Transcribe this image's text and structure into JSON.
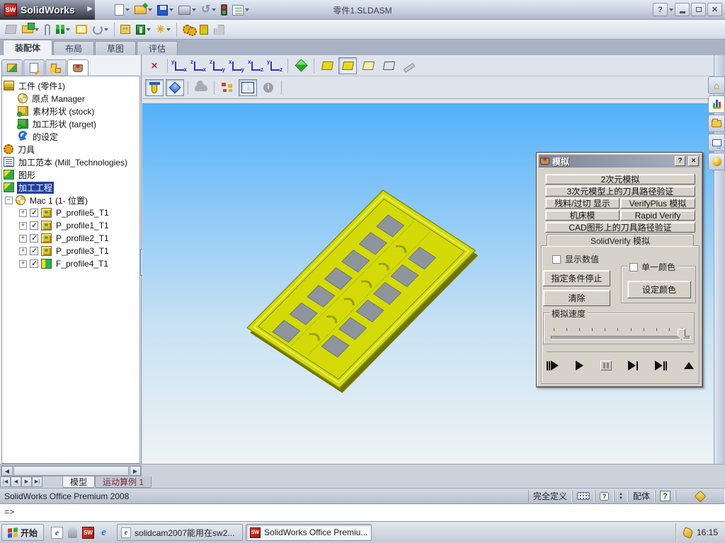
{
  "window": {
    "app_name": "SolidWorks",
    "title": "零件1.SLDASM",
    "help_label": "?"
  },
  "ribbon_tabs": {
    "assembly": "装配体",
    "layout": "布局",
    "sketch": "草图",
    "evaluate": "评估"
  },
  "feature_tree": {
    "items": [
      {
        "label": "工件 (零件1)"
      },
      {
        "label": "原点 Manager"
      },
      {
        "label": "素材形状 (stock)"
      },
      {
        "label": "加工形状 (target)"
      },
      {
        "label": "的设定"
      },
      {
        "label": "刀具"
      },
      {
        "label": "加工范本 (Mill_Technologies)"
      },
      {
        "label": "图形"
      },
      {
        "label": "加工工程"
      },
      {
        "label": "Mac 1 (1- 位置)"
      },
      {
        "label": "P_profile5_T1"
      },
      {
        "label": "P_profile1_T1"
      },
      {
        "label": "P_profile2_T1"
      },
      {
        "label": "P_profile3_T1"
      },
      {
        "label": "F_profile4_T1"
      }
    ]
  },
  "sim_dialog": {
    "title": "模拟",
    "help_label": "?",
    "close_label": "×",
    "btn_2d": "2次元模拟",
    "btn_3d": "3次元模型上的刀具路径验证",
    "btn_residual": "残料/过切 显示",
    "btn_verifyplus": "VerifyPlus 模拟",
    "btn_machine": "机床模",
    "btn_rapid": "Rapid Verify",
    "btn_cad": "CAD图形上的刀具路径验证",
    "tab_solidverify": "SolidVerify 模拟",
    "chk_show_values": "显示数值",
    "btn_stop_condition": "指定条件停止",
    "btn_clear": "清除",
    "grp_single_color": "单一颜色",
    "btn_set_color": "设定颜色",
    "grp_speed": "模拟速度"
  },
  "bottom_tabs": {
    "model": "模型",
    "motion": "运动算例 1"
  },
  "status_bar": {
    "product": "SolidWorks Office Premium 2008",
    "fully_defined": "完全定义",
    "assembly": "配体"
  },
  "command_line": {
    "prompt": "=>"
  },
  "taskbar": {
    "start": "开始",
    "task1": "solidcam2007能用在sw2...",
    "task2": "SolidWorks Office Premiu...",
    "time": "16:15"
  },
  "viewport_colors": {
    "sky_top": "#52b1fb",
    "sky_bottom": "#eef3f4",
    "part_face": "#d3da07",
    "part_edge": "#8a8f00",
    "pad_gray": "#8e949c"
  }
}
